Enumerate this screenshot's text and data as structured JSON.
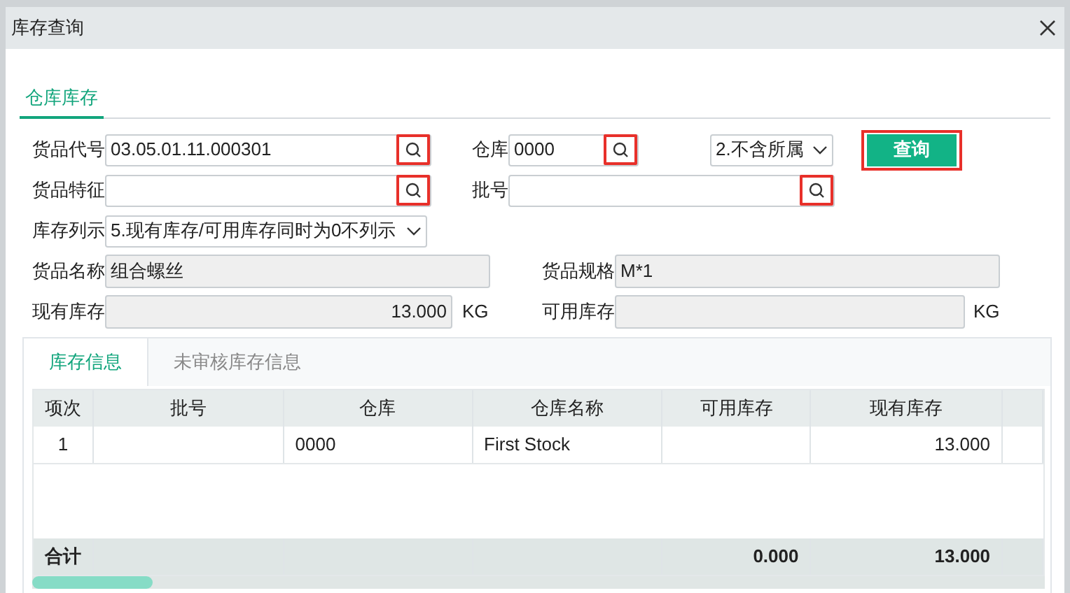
{
  "window": {
    "title": "库存查询"
  },
  "tabs": [
    {
      "label": "仓库库存",
      "selected": true
    }
  ],
  "form": {
    "goods_code": {
      "label": "货品代号",
      "value": "03.05.01.11.000301",
      "highlighted": true
    },
    "warehouse": {
      "label": "仓库",
      "value": "0000",
      "highlighted": true
    },
    "scope": {
      "value": "2.不含所属"
    },
    "query_button": {
      "label": "查询",
      "highlighted": true
    },
    "goods_feature": {
      "label": "货品特征",
      "highlighted": true
    },
    "batch": {
      "label": "批号",
      "highlighted": true
    },
    "list_option": {
      "label": "库存列示",
      "value": "5.现有库存/可用库存同时为0不列示"
    },
    "goods_name": {
      "label": "货品名称",
      "value": "组合螺丝"
    },
    "spec": {
      "label": "货品规格",
      "value": "M*1"
    },
    "on_hand": {
      "label": "现有库存",
      "value": "13.000",
      "unit": "KG"
    },
    "available": {
      "label": "可用库存",
      "unit": "KG"
    }
  },
  "detail_tabs": [
    {
      "label": "库存信息",
      "selected": true
    },
    {
      "label": "未审核库存信息",
      "selected": false
    }
  ],
  "table": {
    "columns": [
      "项次",
      "批号",
      "仓库",
      "仓库名称",
      "可用库存",
      "现有库存"
    ],
    "rows": [
      {
        "item_no": "1",
        "warehouse": "0000",
        "warehouse_name": "First Stock",
        "on_hand": "13.000"
      }
    ],
    "total": {
      "item_no": "合计",
      "available": "0.000",
      "on_hand": "13.000"
    }
  }
}
